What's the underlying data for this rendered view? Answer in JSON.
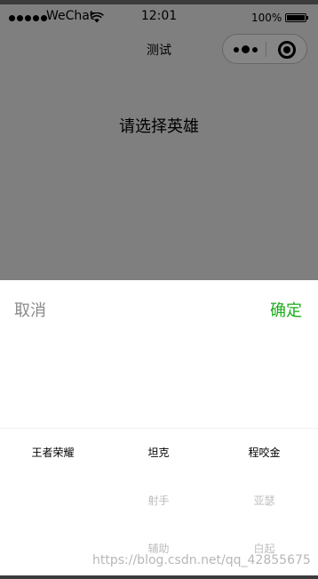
{
  "status_bar": {
    "carrier": "WeChat",
    "time": "12:01",
    "battery": "100%"
  },
  "nav": {
    "title": "测试"
  },
  "page": {
    "label": "请选择英雄"
  },
  "picker": {
    "cancel_label": "取消",
    "confirm_label": "确定",
    "columns": [
      {
        "items": [
          "王者荣耀"
        ]
      },
      {
        "items": [
          "坦克",
          "射手",
          "辅助"
        ]
      },
      {
        "items": [
          "程咬金",
          "亚瑟",
          "白起"
        ]
      }
    ]
  },
  "watermark": "https://blog.csdn.net/qq_42855675",
  "colors": {
    "confirm": "#1aad19",
    "cancel": "#8a8a8a",
    "overlay": "#7f7f7f"
  }
}
